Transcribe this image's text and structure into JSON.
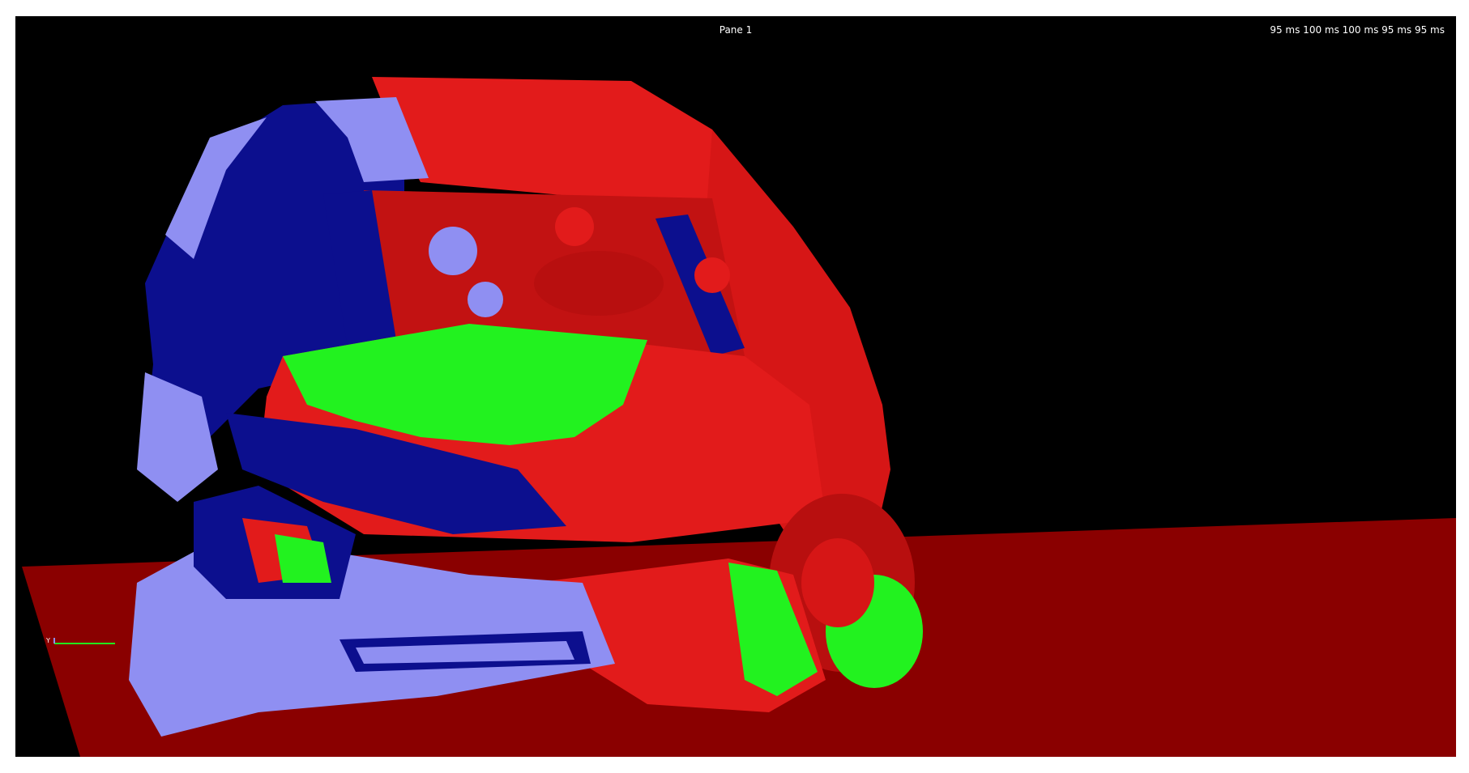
{
  "viewport": {
    "pane_title": "Pane 1",
    "time_readout": "95 ms 100 ms 100 ms 95 ms 95 ms",
    "background_color": "#000000"
  },
  "scene": {
    "subject": "crashed vehicle finite element model",
    "colors": {
      "part_red": "#e21b1b",
      "part_dark_red": "#b80f0f",
      "part_green": "#22f21f",
      "part_dark_blue": "#0c0f8e",
      "part_light_blue": "#8f8ff2",
      "ground_plane": "#8a0000"
    }
  },
  "axis_triad": {
    "label": "Y",
    "icon": "axis-triad-icon"
  }
}
